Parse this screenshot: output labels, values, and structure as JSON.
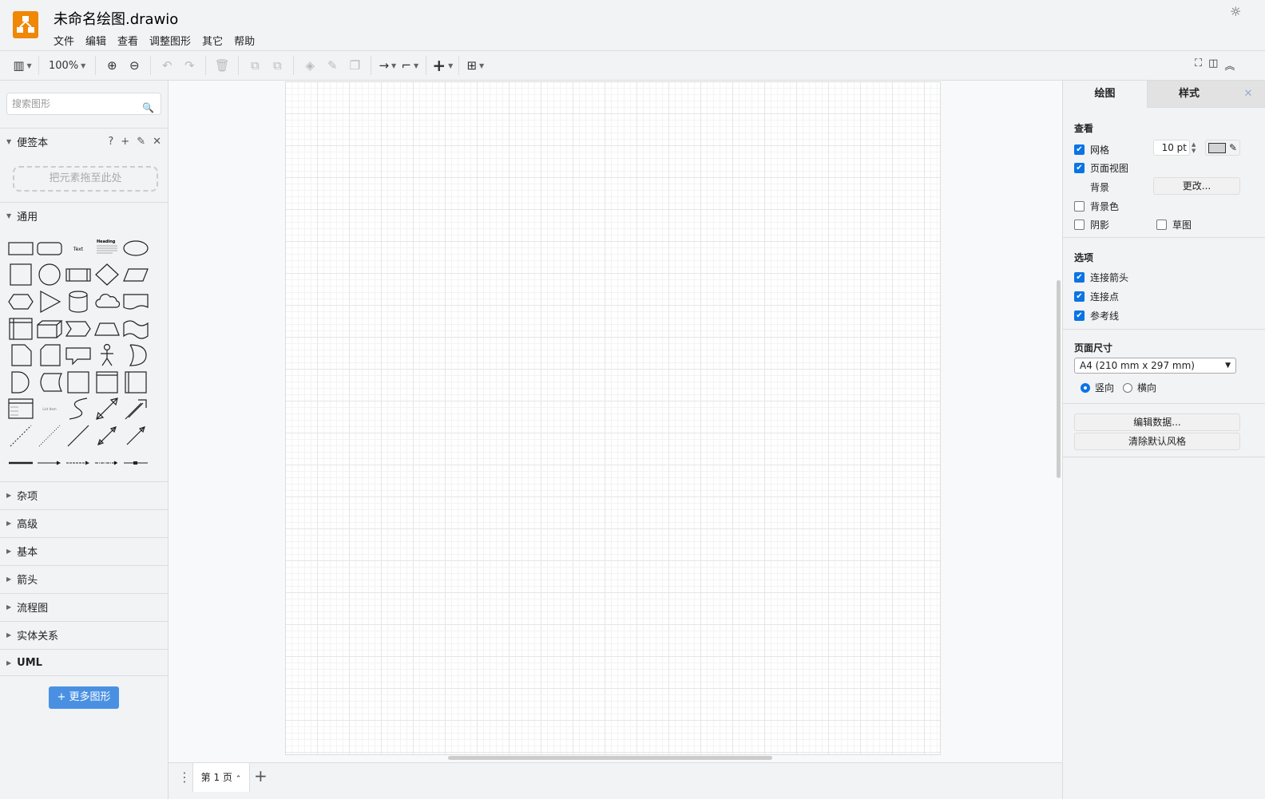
{
  "app": {
    "title": "未命名绘图.drawio",
    "brand_color": "#f08705"
  },
  "menu": [
    "文件",
    "编辑",
    "查看",
    "调整图形",
    "其它",
    "帮助"
  ],
  "toolbar": {
    "zoom": "100%",
    "icons": [
      "format-panel-icon",
      "zoom-in-icon",
      "zoom-out-icon",
      "undo-icon",
      "redo-icon",
      "delete-icon",
      "to-front-icon",
      "to-back-icon",
      "fill-color-icon",
      "line-color-icon",
      "shadow-icon",
      "connection-icon",
      "waypoints-icon",
      "insert-icon",
      "table-icon",
      "fullscreen-icon",
      "toggle-panel-icon",
      "collapse-icon"
    ]
  },
  "sidebar": {
    "search_placeholder": "搜索图形",
    "scratchpad": {
      "title": "便签本",
      "drop_hint": "把元素拖至此处"
    },
    "general_title": "通用",
    "sections": [
      "杂项",
      "高级",
      "基本",
      "箭头",
      "流程图",
      "实体关系",
      "UML"
    ],
    "more_shapes": "+ 更多图形"
  },
  "pages": {
    "current": "第 1 页"
  },
  "format": {
    "tabs": [
      "绘图",
      "样式"
    ],
    "view": {
      "title": "查看",
      "grid": "网格",
      "grid_checked": true,
      "grid_size": "10 pt",
      "page_view": "页面视图",
      "page_view_checked": true,
      "background": "背景",
      "change": "更改...",
      "background_color": "背景色",
      "background_color_checked": false,
      "shadow": "阴影",
      "shadow_checked": false,
      "sketch": "草图",
      "sketch_checked": false,
      "grid_color": "#d3d3d3"
    },
    "options": {
      "title": "选项",
      "connection_arrows": "连接箭头",
      "connection_points": "连接点",
      "guides": "参考线"
    },
    "paper": {
      "title": "页面尺寸",
      "size": "A4 (210 mm x 297 mm)",
      "portrait": "竖向",
      "landscape": "横向",
      "orientation": "portrait"
    },
    "edit_data": "编辑数据...",
    "clear_style": "清除默认风格"
  }
}
